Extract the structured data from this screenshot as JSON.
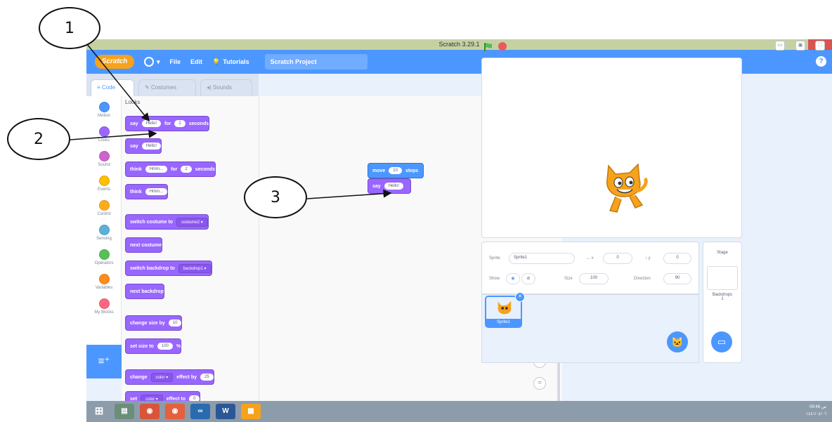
{
  "window": {
    "title": "Scratch 3.29.1",
    "controls": {
      "minimize": "–",
      "maximize": "▫",
      "close": "✕"
    }
  },
  "menubar": {
    "logo": "Scratch",
    "file": "File",
    "edit": "Edit",
    "tutorials": "Tutorials",
    "project_title": "Scratch Project",
    "help": "?"
  },
  "tabs": {
    "code": "Code",
    "costumes": "Costumes",
    "sounds": "Sounds"
  },
  "categories": [
    {
      "label": "Motion",
      "color": "#4c97ff"
    },
    {
      "label": "Looks",
      "color": "#9966ff"
    },
    {
      "label": "Sound",
      "color": "#cf63cf"
    },
    {
      "label": "Events",
      "color": "#ffbf00"
    },
    {
      "label": "Control",
      "color": "#ffab19"
    },
    {
      "label": "Sensing",
      "color": "#5cb1d6"
    },
    {
      "label": "Operators",
      "color": "#59c059"
    },
    {
      "label": "Variables",
      "color": "#ff8c1a"
    },
    {
      "label": "My Blocks",
      "color": "#ff6680"
    }
  ],
  "palette": {
    "section_title": "Looks",
    "say_for": {
      "say": "say",
      "msg": "Hello!",
      "for": "for",
      "secs": "2",
      "seconds": "seconds"
    },
    "say": {
      "say": "say",
      "msg": "Hello!"
    },
    "think_for": {
      "think": "think",
      "msg": "Hmm...",
      "for": "for",
      "secs": "2",
      "seconds": "seconds"
    },
    "think": {
      "think": "think",
      "msg": "Hmm..."
    },
    "switch_costume": {
      "label": "switch costume to",
      "value": "costume2 ▾"
    },
    "next_costume": "next costume",
    "switch_backdrop": {
      "label": "switch backdrop to",
      "value": "backdrop1 ▾"
    },
    "next_backdrop": "next backdrop",
    "change_size": {
      "label": "change size by",
      "value": "10"
    },
    "set_size": {
      "label": "set size to",
      "value": "100",
      "unit": "%"
    },
    "change_effect": {
      "label": "change",
      "effect": "color ▾",
      "by": "effect by",
      "value": "25"
    },
    "set_effect": {
      "label": "set",
      "effect": "color ▾",
      "to": "effect to",
      "value": "0"
    }
  },
  "script": {
    "move": {
      "label": "move",
      "value": "10",
      "unit": "steps"
    },
    "say": {
      "label": "say",
      "value": "Hello!"
    }
  },
  "zoom": {
    "in": "+",
    "out": "−",
    "reset": "="
  },
  "stage_controls": {
    "small": "▭",
    "large": "▣",
    "full": "⛶"
  },
  "sprite_info": {
    "sprite_label": "Sprite",
    "sprite_name": "Sprite1",
    "x_label": "↔ x",
    "x_value": "0",
    "y_label": "↕ y",
    "y_value": "0",
    "show_label": "Show",
    "size_label": "Size",
    "size_value": "100",
    "direction_label": "Direction",
    "direction_value": "90"
  },
  "sprite_list": {
    "sprite_name": "Sprite1",
    "delete": "✕"
  },
  "stage_panel": {
    "title": "Stage",
    "backdrops_label": "Backdrops",
    "backdrops_count": "1"
  },
  "taskbar": {
    "clock_time": "09:46 ص",
    "clock_date": "١٤٤١/٠٤/٠٦",
    "apps": [
      "⊞",
      "▤",
      "◉",
      "◉",
      "∞",
      "W",
      "▦"
    ]
  },
  "callouts": {
    "c1": "1",
    "c2": "2",
    "c3": "3"
  }
}
